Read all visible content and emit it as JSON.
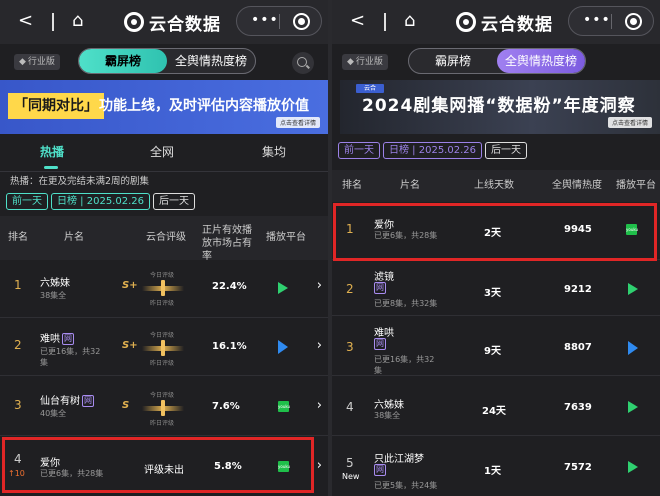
{
  "header": {
    "back": "<",
    "home": "⌂",
    "brand": "云合数据",
    "more": "•••"
  },
  "left": {
    "edition": "行业版",
    "seg": [
      "霸屏榜",
      "全舆情热度榜"
    ],
    "banner_label": "「同期对比」",
    "banner_text": "功能上线，及时评估内容播放价值",
    "banner_detail": "点击查看详情",
    "tabs": [
      "热播",
      "全网",
      "集均"
    ],
    "note": "热播：在更及完结未满2周的剧集",
    "dates": [
      "前一天",
      "日榜 | 2025.02.26",
      "后一天"
    ],
    "cols": [
      "排名",
      "片名",
      "云合评级",
      "正片有效播放市场占有率",
      "播放平台"
    ],
    "rows": [
      {
        "rank": "1",
        "name": "六姊妹",
        "sub": "38集全",
        "grade": "S+",
        "today": "今日评级",
        "yday": "昨日评级",
        "share": "22.4%",
        "platform": "iqiyi",
        "wang": ""
      },
      {
        "rank": "2",
        "name": "难哄",
        "sub": "已更16集，共32集",
        "grade": "S+",
        "today": "今日评级",
        "yday": "昨日评级",
        "share": "16.1%",
        "platform": "tencent",
        "wang": "网"
      },
      {
        "rank": "3",
        "name": "仙台有树",
        "sub": "40集全",
        "grade": "S",
        "today": "今日评级",
        "yday": "昨日评级",
        "share": "7.6%",
        "platform": "youku",
        "wang": "网"
      },
      {
        "rank": "4",
        "name": "爱你",
        "sub": "已更6集，共28集",
        "grade": "评级未出",
        "today": "",
        "yday": "",
        "share": "5.8%",
        "platform": "youku",
        "wang": "",
        "change": "↑10"
      }
    ]
  },
  "right": {
    "edition": "行业版",
    "seg": [
      "霸屏榜",
      "全舆情热度榜"
    ],
    "banner_label": "云合",
    "banner_text": "2024剧集网播“数据粉”年度洞察",
    "banner_detail": "点击查看详情",
    "dates": [
      "前一天",
      "日榜 | 2025.02.26",
      "后一天"
    ],
    "cols": [
      "排名",
      "片名",
      "上线天数",
      "全舆情热度",
      "播放平台"
    ],
    "rows": [
      {
        "rank": "1",
        "name": "爱你",
        "sub": "已更6集，共28集",
        "days": "2天",
        "heat": "9945",
        "platform": "youku",
        "wang": ""
      },
      {
        "rank": "2",
        "name": "滤镜",
        "sub": "已更8集，共32集",
        "days": "3天",
        "heat": "9212",
        "platform": "iqiyi",
        "wang": "网"
      },
      {
        "rank": "3",
        "name": "难哄",
        "sub": "已更16集，共32集",
        "days": "9天",
        "heat": "8807",
        "platform": "tencent",
        "wang": "网"
      },
      {
        "rank": "4",
        "name": "六姊妹",
        "sub": "38集全",
        "days": "24天",
        "heat": "7639",
        "platform": "iqiyi",
        "wang": ""
      },
      {
        "rank": "5",
        "name": "只此江湖梦",
        "sub": "已更5集，共24集",
        "days": "1天",
        "heat": "7572",
        "platform": "iqiyi",
        "wang": "网",
        "new": "New"
      }
    ]
  },
  "colors": {
    "accent": "#4fe0c9",
    "purple": "#9c82e8",
    "highlight": "#e02626",
    "gold": "#e0b050"
  }
}
